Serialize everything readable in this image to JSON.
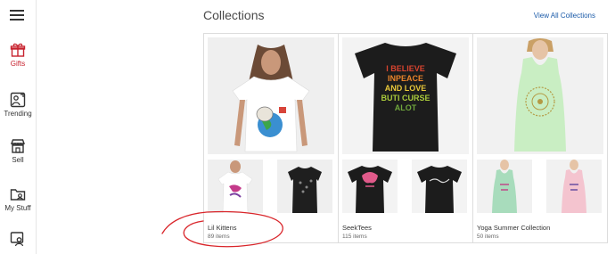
{
  "nav": {
    "items": [
      {
        "label": "Gifts",
        "icon": "gift-icon",
        "active": true
      },
      {
        "label": "Trending",
        "icon": "trending-icon",
        "active": false
      },
      {
        "label": "Sell",
        "icon": "store-icon",
        "active": false
      },
      {
        "label": "My Stuff",
        "icon": "folder-icon",
        "active": false
      },
      {
        "label": "",
        "icon": "account-icon",
        "active": false
      }
    ]
  },
  "header": {
    "title": "Collections",
    "view_all_label": "View All Collections"
  },
  "collections": [
    {
      "name": "Lil Kittens",
      "count": "89 items"
    },
    {
      "name": "SeekTees",
      "count": "115 items"
    },
    {
      "name": "Yoga Summer Collection",
      "count": "50 items"
    }
  ],
  "shirt_text": {
    "big_black": [
      "I BELIEVE",
      "INPEACE",
      "AND LOVE",
      "BUTI CURSE",
      "ALOT"
    ]
  },
  "colors": {
    "accent": "#c7222e",
    "link": "#1a5aa8",
    "annotation": "#d9252a"
  }
}
